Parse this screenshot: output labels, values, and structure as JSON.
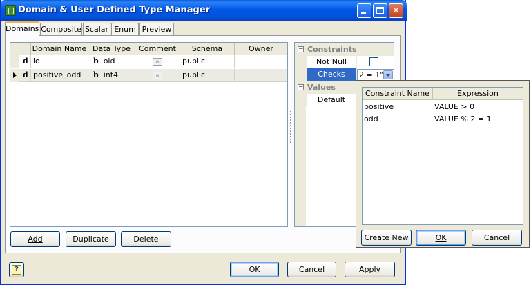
{
  "window": {
    "title": "Domain & User Defined Type Manager"
  },
  "tabs": [
    {
      "label": "Domains",
      "active": true
    },
    {
      "label": "Composite",
      "active": false
    },
    {
      "label": "Scalar",
      "active": false
    },
    {
      "label": "Enum",
      "active": false
    },
    {
      "label": "Preview",
      "active": false
    }
  ],
  "grid": {
    "columns": [
      "Domain Name",
      "Data Type",
      "Comment",
      "Schema",
      "Owner"
    ],
    "rows": [
      {
        "icon_glyph": "d",
        "name": "lo",
        "type_glyph": "b",
        "type": "oid",
        "comment_icon": "a",
        "schema": "public",
        "owner": "",
        "selected": false
      },
      {
        "icon_glyph": "d",
        "name": "positive_odd",
        "type_glyph": "b",
        "type": "int4",
        "comment_icon": "a",
        "schema": "public",
        "owner": "",
        "selected": true
      }
    ]
  },
  "grid_buttons": {
    "add": "Add",
    "duplicate": "Duplicate",
    "delete": "Delete"
  },
  "properties": {
    "constraints_label": "Constraints",
    "not_null_label": "Not Null",
    "not_null_checked": false,
    "checks_label": "Checks",
    "checks_value": "2 = 1\"",
    "values_label": "Values",
    "default_label": "Default",
    "collapse_glyph": "−"
  },
  "popup": {
    "columns": [
      "Constraint Name",
      "Expression"
    ],
    "rows": [
      {
        "name": "positive",
        "expression": "VALUE > 0"
      },
      {
        "name": "odd",
        "expression": "VALUE % 2 = 1"
      }
    ],
    "create_new": "Create New",
    "ok": "OK",
    "cancel": "Cancel"
  },
  "dialog_buttons": {
    "ok": "OK",
    "cancel": "Cancel",
    "apply": "Apply",
    "help": "?"
  },
  "colors": {
    "titlebar": "#0058e6",
    "selection": "#316ac5",
    "dialog_bg": "#ece9d8"
  }
}
